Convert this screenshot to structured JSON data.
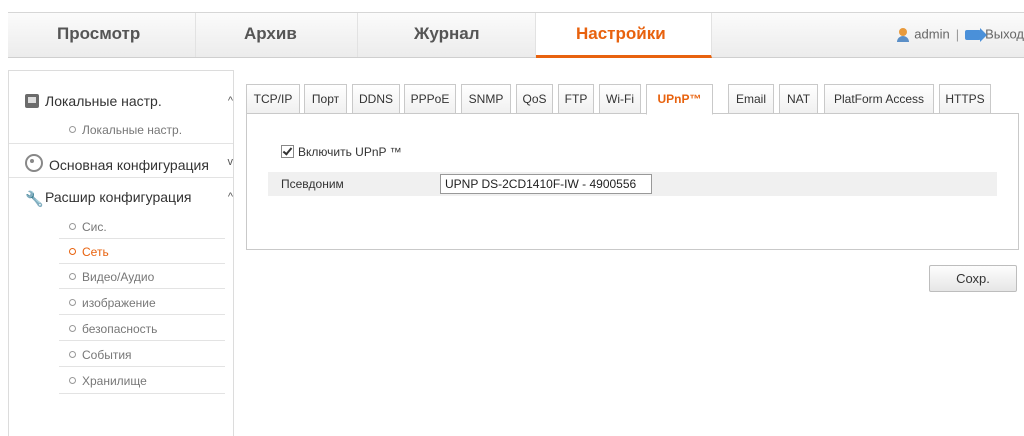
{
  "topnav": {
    "tabs": [
      "Просмотр",
      "Архив",
      "Журнал",
      "Настройки"
    ],
    "active": "Настройки",
    "user": "admin",
    "separator": "|",
    "logout": "Выход"
  },
  "sidebar": {
    "local": {
      "title": "Локальные настр.",
      "items": [
        "Локальные настр."
      ]
    },
    "basic": {
      "title": "Основная конфигурация"
    },
    "advanced": {
      "title": "Расшир конфигурация",
      "items": [
        "Сис.",
        "Сеть",
        "Видео/Аудио",
        "изображение",
        "безопасность",
        "События",
        "Хранилище"
      ],
      "active": "Сеть"
    }
  },
  "tabs": [
    "TCP/IP",
    "Порт",
    "DDNS",
    "PPPoE",
    "SNMP",
    "QoS",
    "FTP",
    "Wi-Fi",
    "UPnP™",
    "Email",
    "NAT",
    "PlatForm Access",
    "HTTPS"
  ],
  "active_tab": "UPnP™",
  "upnp": {
    "enable_label": "Включить UPnP ™",
    "enabled": true,
    "alias_label": "Псевдоним",
    "alias_value": "UPNP DS-2CD1410F-IW - 4900556"
  },
  "save_label": "Сохр.",
  "colors": {
    "accent": "#e8620e",
    "row_bg": "#f0f0f0"
  }
}
